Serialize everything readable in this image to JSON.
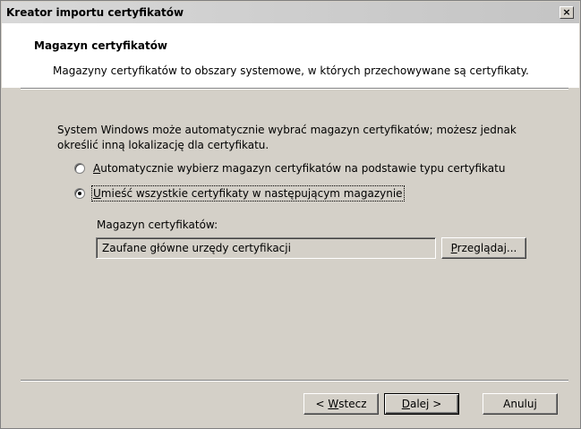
{
  "window": {
    "title": "Kreator importu certyfikatów",
    "close_glyph": "×"
  },
  "header": {
    "title": "Magazyn certyfikatów",
    "subtitle": "Magazyny certyfikatów to obszary systemowe, w których przechowywane są certyfikaty."
  },
  "body": {
    "description_line1": "System Windows może automatycznie wybrać magazyn certyfikatów; możesz jednak",
    "description_line2": "określić inną lokalizację dla certyfikatu.",
    "option_auto": {
      "label_mnemonic": "A",
      "label_rest": "utomatycznie wybierz magazyn certyfikatów na podstawie typu certyfikatu",
      "checked": false
    },
    "option_manual": {
      "label_mnemonic": "U",
      "label_rest": "mieść wszystkie certyfikaty w następującym magazynie",
      "checked": true
    },
    "store_label": "Magazyn certyfikatów:",
    "store_value": "Zaufane główne urzędy certyfikacji",
    "browse_button": {
      "mnemonic": "P",
      "rest": "rzeglądaj..."
    }
  },
  "footer": {
    "back_button": {
      "prefix": "< ",
      "mnemonic": "W",
      "rest": "stecz"
    },
    "next_button": {
      "mnemonic": "D",
      "rest": "alej >"
    },
    "cancel_button": "Anuluj"
  }
}
